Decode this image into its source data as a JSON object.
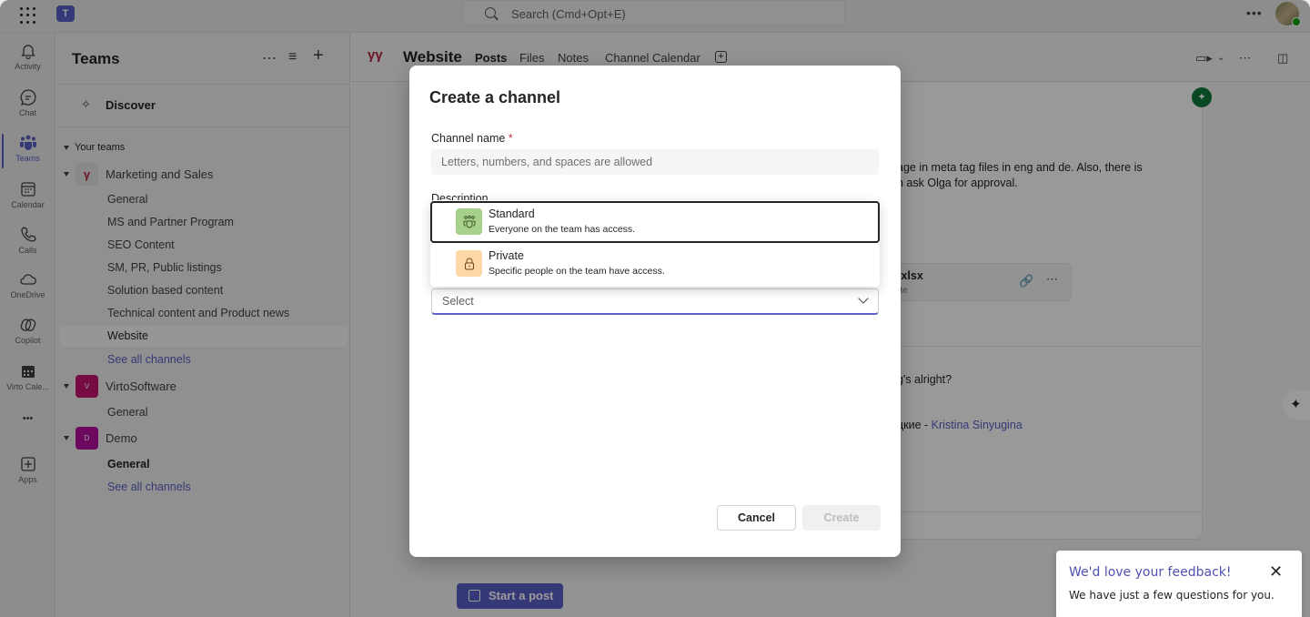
{
  "titlebar": {
    "search_placeholder": "Search (Cmd+Opt+E)",
    "more": "…"
  },
  "rail": [
    {
      "id": "activity",
      "label": "Activity",
      "icon": "bell-icon"
    },
    {
      "id": "chat",
      "label": "Chat",
      "icon": "chat-icon"
    },
    {
      "id": "teams",
      "label": "Teams",
      "icon": "teams-icon",
      "active": true
    },
    {
      "id": "calendar",
      "label": "Calendar",
      "icon": "calendar-icon"
    },
    {
      "id": "calls",
      "label": "Calls",
      "icon": "phone-icon"
    },
    {
      "id": "onedrive",
      "label": "OneDrive",
      "icon": "cloud-icon"
    },
    {
      "id": "copilot",
      "label": "Copilot",
      "icon": "copilot-icon"
    },
    {
      "id": "virto",
      "label": "Virto Cale...",
      "icon": "virto-calendar-icon"
    },
    {
      "id": "more",
      "label": "•••",
      "icon": "more-icon"
    },
    {
      "id": "apps",
      "label": "Apps",
      "icon": "apps-plus-icon"
    }
  ],
  "teams_pane": {
    "title": "Teams",
    "discover": "Discover",
    "section": "Your teams",
    "teams": [
      {
        "name": "Marketing and Sales",
        "badge": "",
        "channels": [
          "General",
          "MS and Partner Program",
          "SEO Content",
          "SM, PR, Public listings",
          "Solution based content",
          "Technical content and Product news",
          "Website"
        ],
        "selected": "Website",
        "see_all": "See all channels"
      },
      {
        "name": "VirtoSoftware",
        "badge": "V",
        "channels": [
          "General"
        ]
      },
      {
        "name": "Demo",
        "badge": "D",
        "channels": [
          "General"
        ],
        "see_all": "See all channels"
      }
    ]
  },
  "channel_header": {
    "name": "Website",
    "tabs": [
      "Posts",
      "Files",
      "Notes",
      "Channel Calendar"
    ],
    "active_tab": "Posts"
  },
  "feed": {
    "line1": "age in meta tag files in eng and de. Also, there is",
    "line2": "n ask Olga for approval.",
    "file_name": ".xlsx",
    "file_sub": "ite",
    "line3": "g's alright?",
    "line4_prefix": "цкие - ",
    "line4_mention": "Kristina Sinyugina",
    "start_post": "Start a post"
  },
  "dialog": {
    "title": "Create a channel",
    "name_label": "Channel name",
    "required_mark": "*",
    "name_placeholder": "Letters, numbers, and spaces are allowed",
    "name_value": "",
    "description_label": "Description",
    "privacy_value": "Select",
    "options": [
      {
        "title": "Standard",
        "desc": "Everyone on the team has access.",
        "color": "#a6d08b"
      },
      {
        "title": "Private",
        "desc": "Specific people on the team have access.",
        "color": "#fdd8a6"
      }
    ],
    "cancel": "Cancel",
    "create": "Create"
  },
  "toast": {
    "title": "We'd love your feedback!",
    "body": "We have just a few questions for you."
  },
  "colors": {
    "accent": "#5b5fc7",
    "brand_red": "#b4233e",
    "virto_badge": "#c4136b",
    "demo_badge": "#b4109e",
    "pin_green": "#0e7a3b"
  }
}
